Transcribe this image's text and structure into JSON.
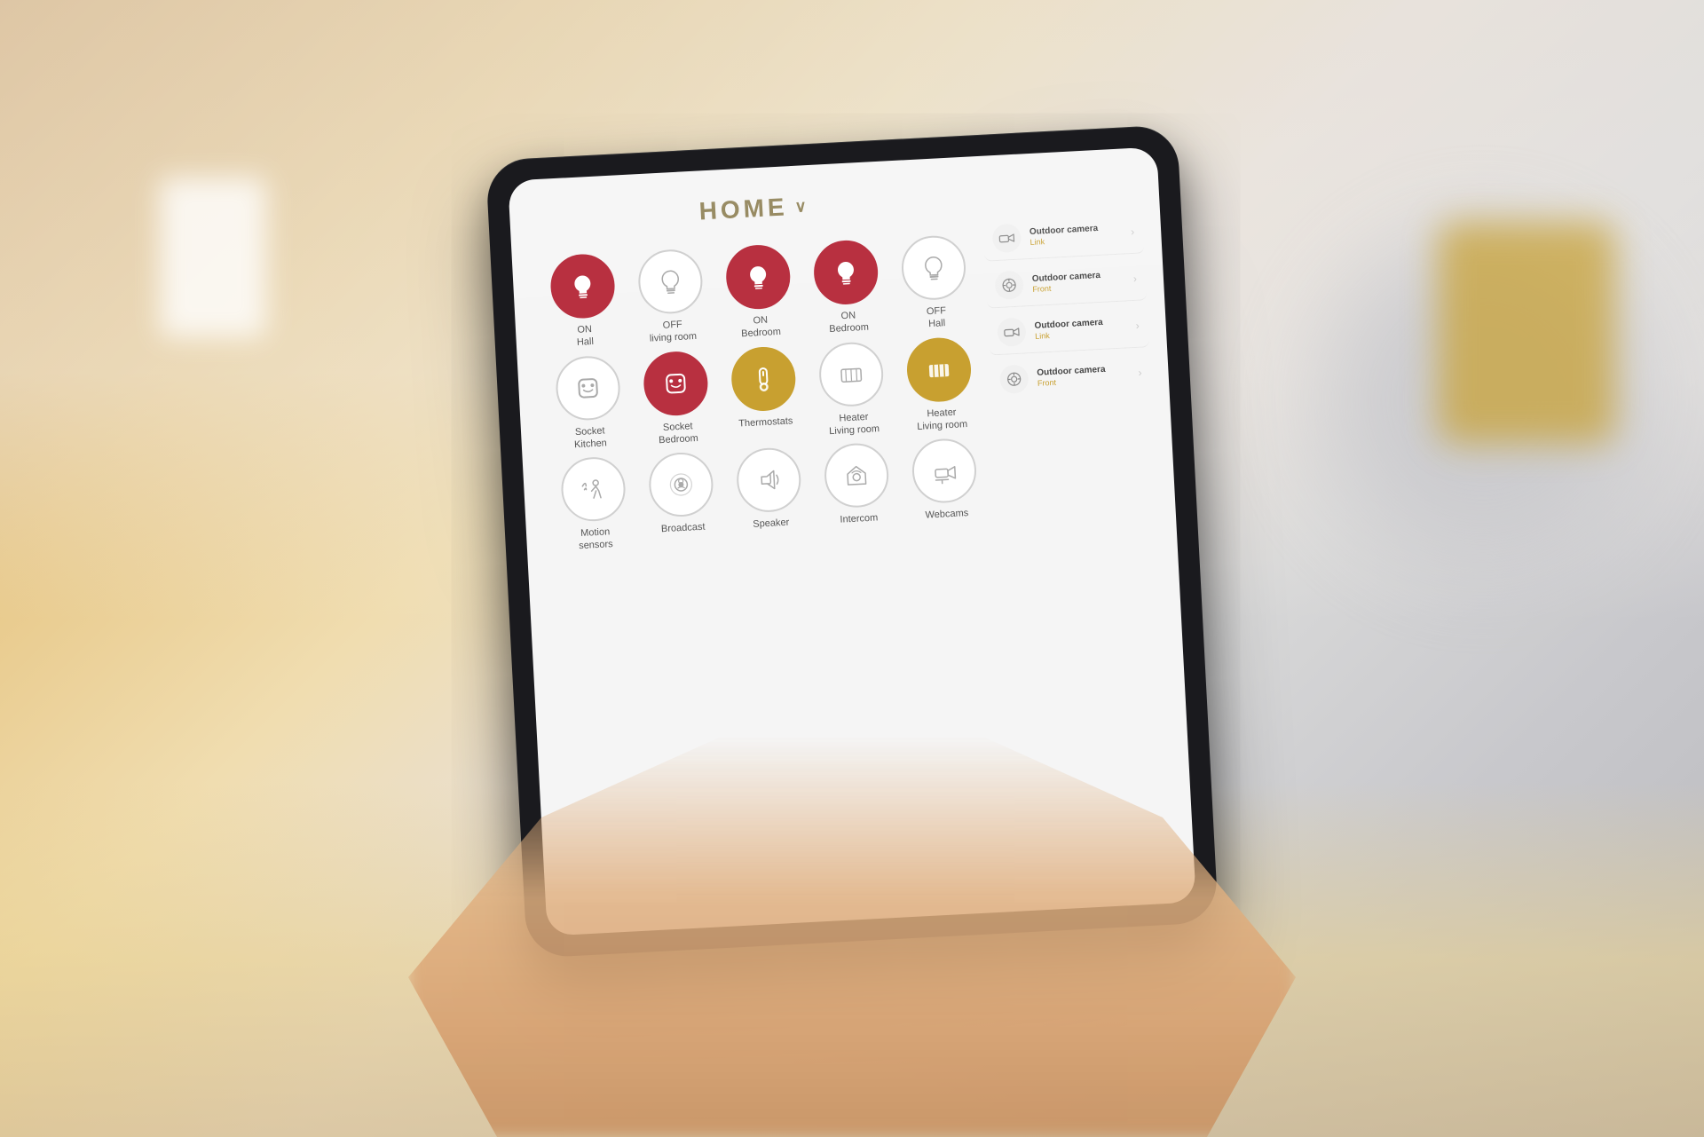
{
  "scene": {
    "background_description": "Smart home tablet UI being held by a person in a living room"
  },
  "app": {
    "title": "HOME",
    "title_chevron": "∨"
  },
  "devices": [
    {
      "id": "light-hall",
      "icon_type": "bulb-on",
      "style": "active-red",
      "label": "ON\nHall",
      "label_line1": "ON",
      "label_line2": "Hall"
    },
    {
      "id": "light-living-room",
      "icon_type": "bulb-off",
      "style": "inactive-outline",
      "label": "OFF\nliving room",
      "label_line1": "OFF",
      "label_line2": "living room"
    },
    {
      "id": "light-bedroom-1",
      "icon_type": "bulb-on",
      "style": "active-red",
      "label": "ON\nBedroom",
      "label_line1": "ON",
      "label_line2": "Bedroom"
    },
    {
      "id": "light-bedroom-2",
      "icon_type": "bulb-on",
      "style": "active-red",
      "label": "ON\nBedroom",
      "label_line1": "ON",
      "label_line2": "Bedroom"
    },
    {
      "id": "light-hall-off",
      "icon_type": "bulb-off",
      "style": "inactive-outline",
      "label": "OFF\nHall",
      "label_line1": "OFF",
      "label_line2": "Hall"
    },
    {
      "id": "socket-kitchen",
      "icon_type": "socket",
      "style": "inactive-outline",
      "label": "Socket\nKitchen",
      "label_line1": "Socket",
      "label_line2": "Kitchen"
    },
    {
      "id": "socket-bedroom",
      "icon_type": "socket",
      "style": "active-red",
      "label": "Socket\nBedroom",
      "label_line1": "Socket",
      "label_line2": "Bedroom"
    },
    {
      "id": "thermostats",
      "icon_type": "thermostat",
      "style": "active-gold",
      "label": "Thermostats",
      "label_line1": "Thermostats",
      "label_line2": ""
    },
    {
      "id": "heater-living-room",
      "icon_type": "heater",
      "style": "inactive-outline",
      "label": "Heater\nLiving room",
      "label_line1": "Heater",
      "label_line2": "Living room"
    },
    {
      "id": "heater-living-room-2",
      "icon_type": "heater-2",
      "style": "active-gold",
      "label": "Heater\nLiving room",
      "label_line1": "Heater",
      "label_line2": "Living room"
    },
    {
      "id": "motion-sensors",
      "icon_type": "motion",
      "style": "inactive-outline",
      "label": "Motion\nsensors",
      "label_line1": "Motion",
      "label_line2": "sensors"
    },
    {
      "id": "broadcast",
      "icon_type": "broadcast",
      "style": "inactive-outline",
      "label": "Broadcast",
      "label_line1": "Broadcast",
      "label_line2": ""
    },
    {
      "id": "speaker",
      "icon_type": "speaker",
      "style": "inactive-outline",
      "label": "Speaker",
      "label_line1": "Speaker",
      "label_line2": ""
    },
    {
      "id": "intercom",
      "icon_type": "intercom",
      "style": "inactive-outline",
      "label": "Intercom",
      "label_line1": "Intercom",
      "label_line2": ""
    },
    {
      "id": "webcams",
      "icon_type": "webcam",
      "style": "inactive-outline",
      "label": "Webcams",
      "label_line1": "Webcams",
      "label_line2": ""
    }
  ],
  "cameras": [
    {
      "id": "cam-1",
      "name": "Outdoor camera",
      "location": "Link"
    },
    {
      "id": "cam-2",
      "name": "Outdoor camera",
      "location": "Front"
    },
    {
      "id": "cam-3",
      "name": "Outdoor camera",
      "location": "Link"
    },
    {
      "id": "cam-4",
      "name": "Outdoor camera",
      "location": "Front"
    }
  ]
}
